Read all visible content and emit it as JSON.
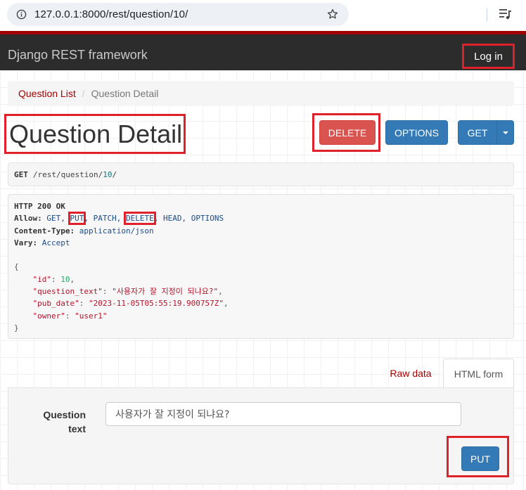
{
  "browser": {
    "url": "127.0.0.1:8000/rest/question/10/"
  },
  "navbar": {
    "brand": "Django REST framework",
    "login_label": "Log in",
    "accent_color": "#a30000"
  },
  "breadcrumb": {
    "items": [
      "Question List",
      "Question Detail"
    ],
    "separator": "/"
  },
  "page": {
    "title": "Question Detail"
  },
  "actions": {
    "delete_label": "DELETE",
    "options_label": "OPTIONS",
    "get_label": "GET"
  },
  "request": {
    "method": "GET",
    "path": "/rest/question/",
    "id": "10",
    "trailing": "/"
  },
  "response": {
    "status_line": "HTTP 200 OK",
    "allow_label": "Allow:",
    "allow_methods": [
      "GET",
      "PUT",
      "PATCH",
      "DELETE",
      "HEAD",
      "OPTIONS"
    ],
    "content_type_label": "Content-Type:",
    "content_type": "application/json",
    "vary_label": "Vary:",
    "vary": "Accept",
    "body": {
      "id": "10",
      "question_text": "\"사용자가 잘 지정이 되냐요?\"",
      "pub_date": "\"2023-11-05T05:55:19.900757Z\"",
      "owner": "\"user1\""
    }
  },
  "tabs": {
    "raw": "Raw data",
    "html": "HTML form"
  },
  "form": {
    "label": "Question text",
    "value": "사용자가 잘 지정이 되냐요?",
    "submit_label": "PUT"
  }
}
